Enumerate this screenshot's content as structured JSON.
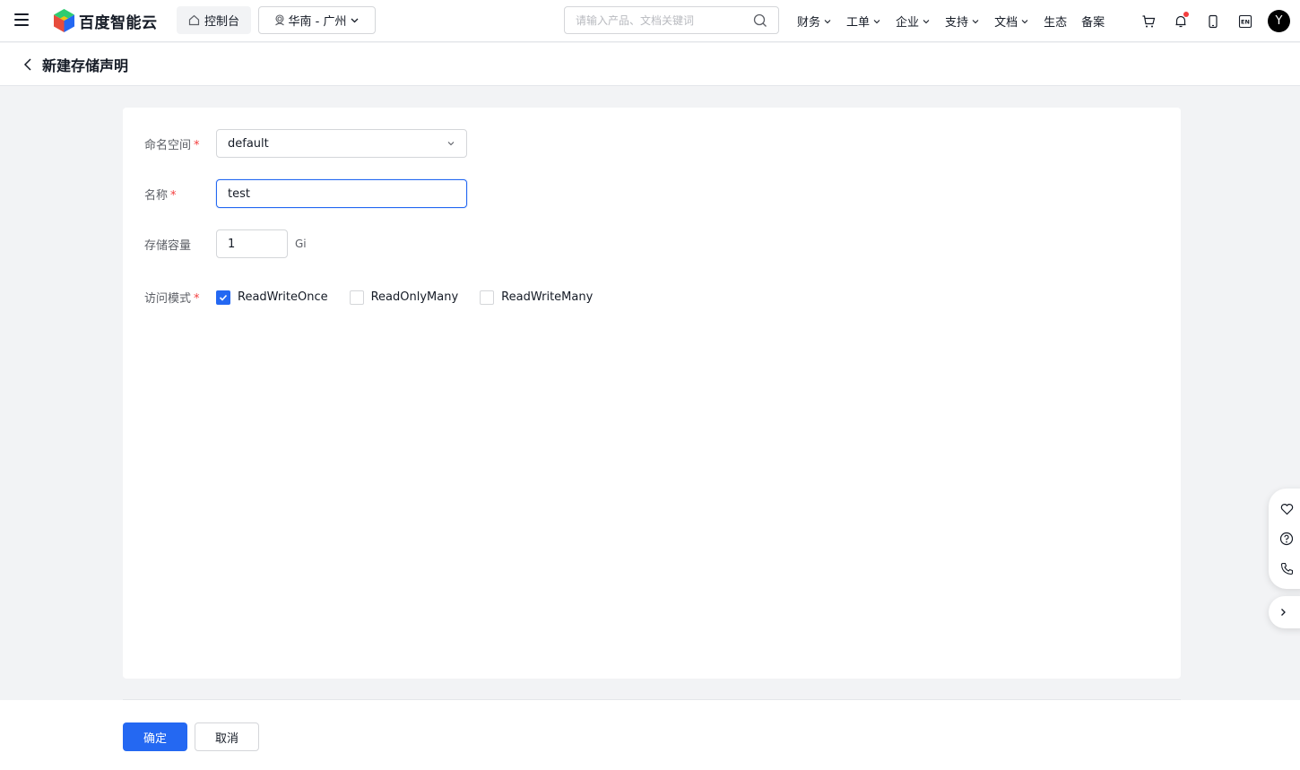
{
  "topbar": {
    "menu_icon": "menu-icon",
    "logo_text": "百度智能云",
    "console_label": "控制台",
    "region_label": "华南 - 广州",
    "search_placeholder": "请输入产品、文档关键词",
    "nav": [
      {
        "label": "财务",
        "dropdown": true
      },
      {
        "label": "工单",
        "dropdown": true
      },
      {
        "label": "企业",
        "dropdown": true
      },
      {
        "label": "支持",
        "dropdown": true
      },
      {
        "label": "文档",
        "dropdown": true
      },
      {
        "label": "生态",
        "dropdown": false
      },
      {
        "label": "备案",
        "dropdown": false
      }
    ],
    "icons": [
      "cart-icon",
      "bell-icon",
      "mobile-icon",
      "language-icon"
    ],
    "language_label": "EN",
    "avatar_initial": "Y"
  },
  "page": {
    "title": "新建存储声明"
  },
  "form": {
    "namespace": {
      "label": "命名空间",
      "required": true,
      "value": "default"
    },
    "name": {
      "label": "名称",
      "required": true,
      "value": "test"
    },
    "capacity": {
      "label": "存储容量",
      "required": false,
      "value": "1",
      "unit": "Gi"
    },
    "access_mode": {
      "label": "访问模式",
      "required": true,
      "options": [
        {
          "label": "ReadWriteOnce",
          "checked": true
        },
        {
          "label": "ReadOnlyMany",
          "checked": false
        },
        {
          "label": "ReadWriteMany",
          "checked": false
        }
      ]
    },
    "required_mark": "*"
  },
  "footer": {
    "confirm_label": "确定",
    "cancel_label": "取消"
  },
  "colors": {
    "primary": "#2468f2",
    "required": "#f33e3e",
    "background": "#f2f3f5"
  }
}
